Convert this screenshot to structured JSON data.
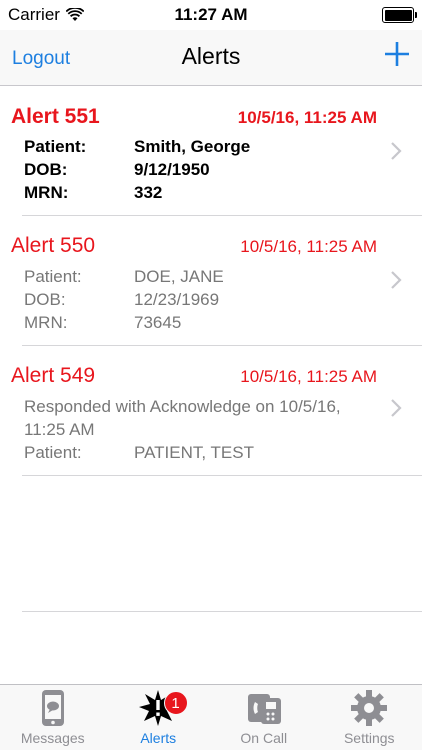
{
  "status_bar": {
    "carrier": "Carrier",
    "time": "11:27 AM"
  },
  "nav": {
    "left_label": "Logout",
    "title": "Alerts",
    "add_icon": "plus-icon"
  },
  "alerts": [
    {
      "title": "Alert 551",
      "time": "10/5/16, 11:25 AM",
      "unread": true,
      "fields": [
        {
          "label": "Patient:",
          "value": "Smith, George"
        },
        {
          "label": "DOB:",
          "value": "9/12/1950"
        },
        {
          "label": "MRN:",
          "value": "332"
        }
      ]
    },
    {
      "title": "Alert 550",
      "time": "10/5/16, 11:25 AM",
      "unread": false,
      "fields": [
        {
          "label": "Patient:",
          "value": "DOE, JANE"
        },
        {
          "label": "DOB:",
          "value": "12/23/1969"
        },
        {
          "label": "MRN:",
          "value": "73645"
        }
      ]
    },
    {
      "title": "Alert 549",
      "time": "10/5/16, 11:25 AM",
      "unread": false,
      "note": "Responded with Acknowledge on 10/5/16, 11:25 AM",
      "fields": [
        {
          "label": "Patient:",
          "value": "PATIENT, TEST"
        }
      ]
    }
  ],
  "tabs": [
    {
      "label": "Messages",
      "icon": "messages-phone-icon",
      "active": false
    },
    {
      "label": "Alerts",
      "icon": "alert-burst-icon",
      "active": true,
      "badge": "1"
    },
    {
      "label": "On Call",
      "icon": "on-call-phone-icon",
      "active": false
    },
    {
      "label": "Settings",
      "icon": "gear-icon",
      "active": false
    }
  ],
  "colors": {
    "accent": "#1d7fe0",
    "alert_red": "#e8161d",
    "badge_red": "#e8161d"
  }
}
